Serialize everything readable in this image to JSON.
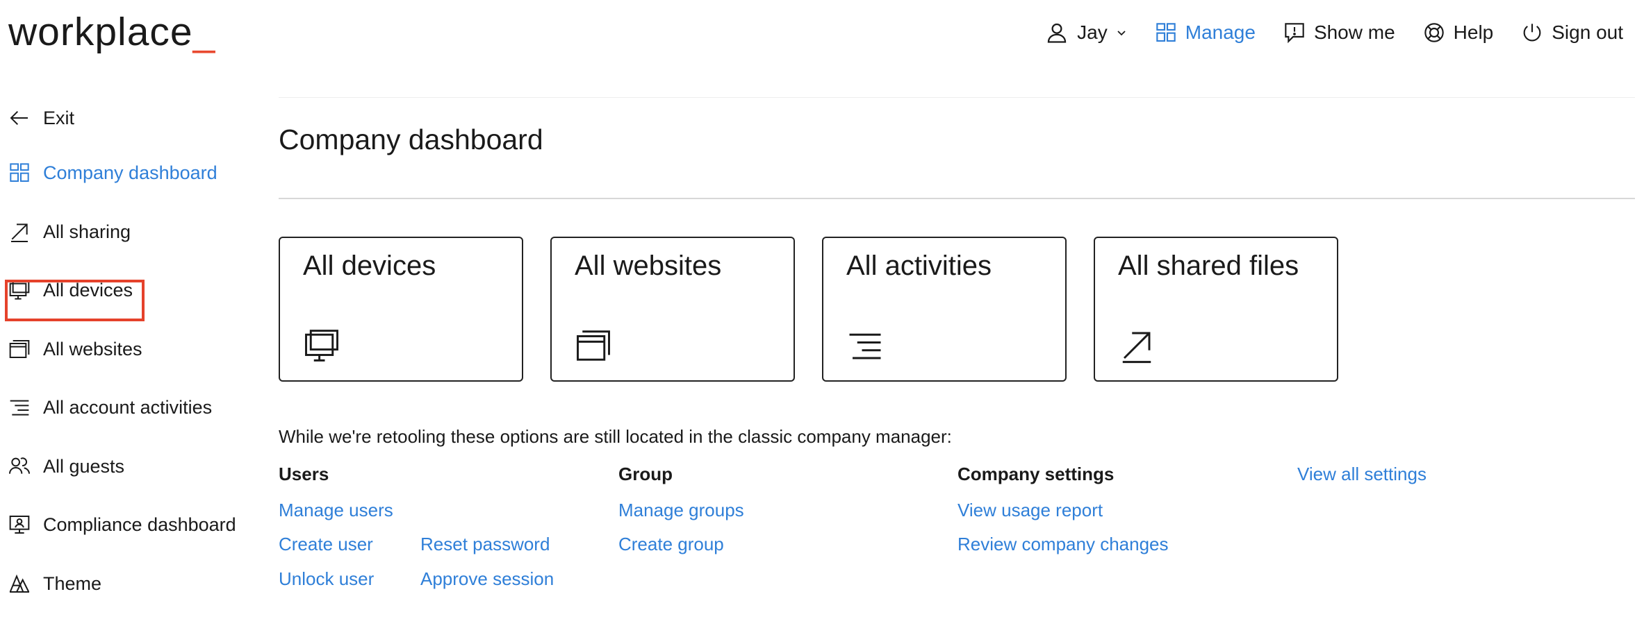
{
  "logo": {
    "text": "workplace",
    "cursor": "_"
  },
  "topnav": {
    "user": "Jay",
    "manage": "Manage",
    "show_me": "Show me",
    "help": "Help",
    "sign_out": "Sign out"
  },
  "sidebar": {
    "items": [
      {
        "label": "Exit",
        "icon": "arrow-left-icon"
      },
      {
        "label": "Company dashboard",
        "icon": "grid-icon",
        "active": true
      },
      {
        "label": "All sharing",
        "icon": "share-arrow-icon"
      },
      {
        "label": "All devices",
        "icon": "devices-icon",
        "highlighted": true
      },
      {
        "label": "All websites",
        "icon": "windows-icon"
      },
      {
        "label": "All account activities",
        "icon": "activity-lines-icon"
      },
      {
        "label": "All guests",
        "icon": "guests-icon"
      },
      {
        "label": "Compliance dashboard",
        "icon": "compliance-monitor-icon"
      },
      {
        "label": "Theme",
        "icon": "theme-icon"
      }
    ]
  },
  "main": {
    "title": "Company dashboard",
    "cards": [
      {
        "title": "All devices",
        "icon": "devices-icon"
      },
      {
        "title": "All websites",
        "icon": "windows-icon"
      },
      {
        "title": "All activities",
        "icon": "activity-lines-icon"
      },
      {
        "title": "All shared files",
        "icon": "share-arrow-icon"
      }
    ],
    "intro": "While we're retooling these options are still located in the classic company manager:",
    "users": {
      "heading": "Users",
      "manage_users": "Manage users",
      "create_user": "Create user",
      "reset_password": "Reset password",
      "unlock_user": "Unlock user",
      "approve_session": "Approve session"
    },
    "group": {
      "heading": "Group",
      "manage_groups": "Manage groups",
      "create_group": "Create group"
    },
    "company_settings": {
      "heading": "Company settings",
      "view_usage_report": "View usage report",
      "review_company_changes": "Review company changes"
    },
    "view_all_settings": "View all settings"
  },
  "colors": {
    "accent": "#2f7fd8",
    "logo_cursor": "#e8492f",
    "highlight": "#e5422b",
    "text": "#1a1a1a"
  }
}
